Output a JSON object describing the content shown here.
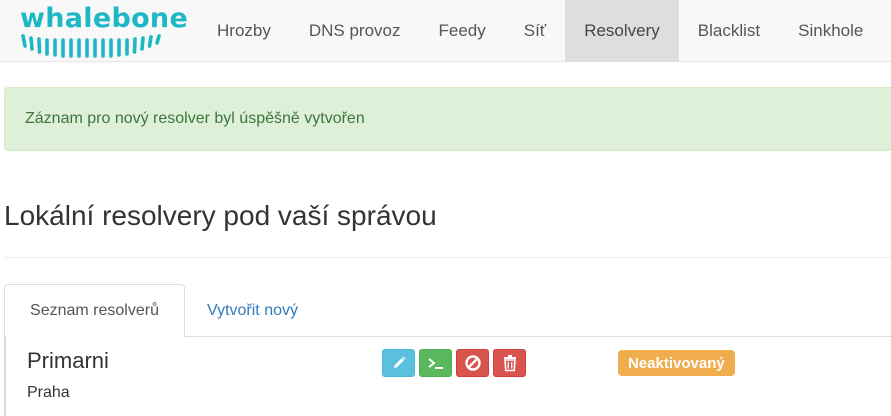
{
  "brand": {
    "name": "whalebone",
    "color": "#1eb8c4"
  },
  "nav": {
    "items": [
      {
        "label": "Hrozby",
        "active": false
      },
      {
        "label": "DNS provoz",
        "active": false
      },
      {
        "label": "Feedy",
        "active": false
      },
      {
        "label": "Síť",
        "active": false
      },
      {
        "label": "Resolvery",
        "active": true
      },
      {
        "label": "Blacklist",
        "active": false
      },
      {
        "label": "Sinkhole",
        "active": false
      }
    ]
  },
  "alert": {
    "message": "Záznam pro nový resolver byl úspěšně vytvořen",
    "type": "success"
  },
  "page": {
    "title": "Lokální resolvery pod vaší správou"
  },
  "tabs": [
    {
      "label": "Seznam resolverů",
      "active": true
    },
    {
      "label": "Vytvořit nový",
      "active": false
    }
  ],
  "resolver": {
    "name": "Primarni",
    "location": "Praha",
    "status": "Neaktivovaný",
    "status_color": "#f0ad4e",
    "actions": [
      {
        "icon": "pencil-icon",
        "color": "#5bc0de"
      },
      {
        "icon": "terminal-icon",
        "color": "#5cb85c"
      },
      {
        "icon": "ban-icon",
        "color": "#d9534f"
      },
      {
        "icon": "trash-icon",
        "color": "#d9534f"
      }
    ]
  }
}
